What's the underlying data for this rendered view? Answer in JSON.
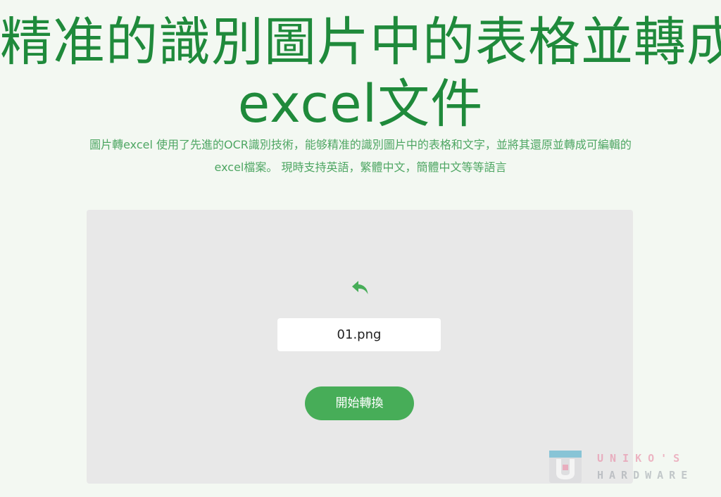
{
  "header": {
    "title_line1": "精准的識別圖片中的表格並轉成",
    "title_line2": "excel文件",
    "subtitle_line1": "圖片轉excel 使用了先進的OCR識別技術，能够精准的識別圖片中的表格和文字，並將其還原並轉成可編輯的",
    "subtitle_line2": "excel檔案。 現時支持英語，繁體中文，簡體中文等等語言"
  },
  "upload": {
    "reset_icon": "undo-arrow-icon",
    "file_name": "01.png",
    "convert_label": "開始轉換"
  },
  "watermark": {
    "logo_icon": "uniko-logo-icon",
    "brand": "UNIKO'S",
    "sub": "HARDWARE"
  },
  "colors": {
    "title": "#1f8a3b",
    "subtitle": "#4ea663",
    "panel_bg": "#e8e8e8",
    "button_bg": "#47ad58",
    "icon": "#47ad58"
  }
}
